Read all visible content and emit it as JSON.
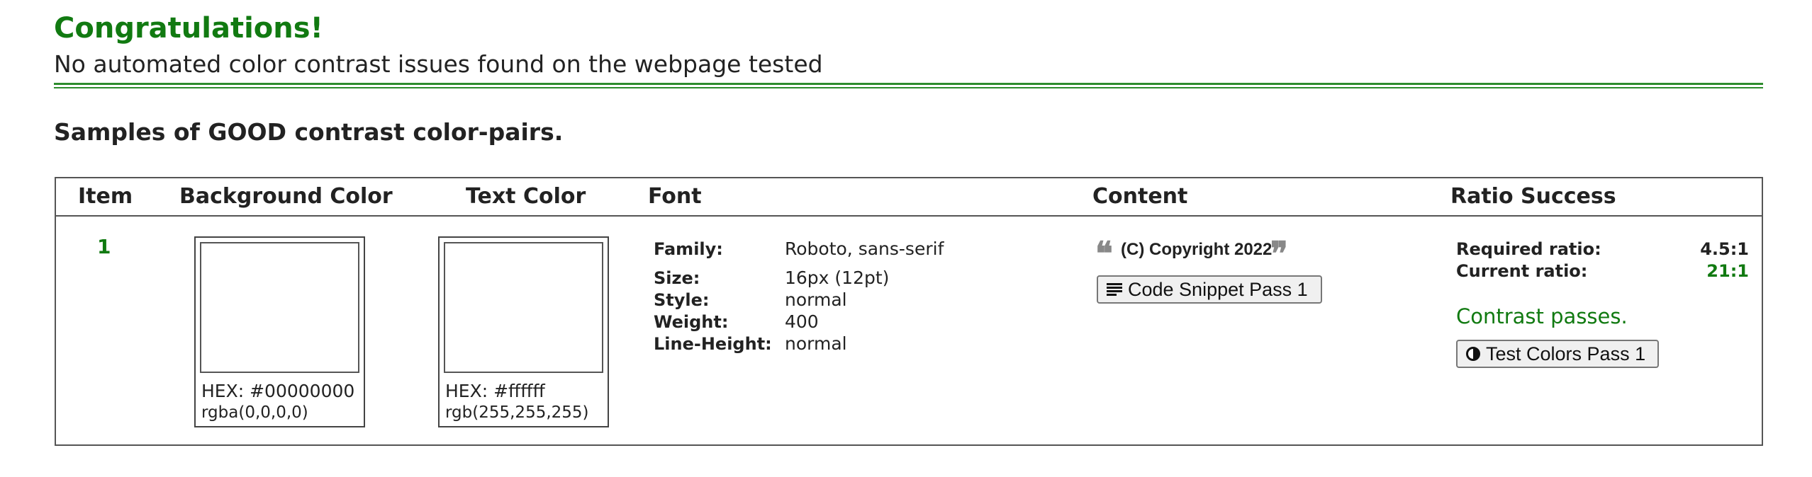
{
  "banner": {
    "title": "Congratulations!",
    "subtitle": "No automated color contrast issues found on the webpage tested"
  },
  "section": {
    "title": "Samples of GOOD contrast color-pairs."
  },
  "table": {
    "headers": {
      "item": "Item",
      "background": "Background Color",
      "text": "Text Color",
      "font": "Font",
      "content": "Content",
      "ratio": "Ratio Success"
    },
    "rows": [
      {
        "item": "1",
        "background": {
          "hex_label": "HEX: #00000000",
          "rgb_label": "rgba(0,0,0,0)",
          "swatch_color": "#ffffff"
        },
        "text": {
          "hex_label": "HEX: #ffffff",
          "rgb_label": "rgb(255,255,255)",
          "swatch_color": "#ffffff"
        },
        "font": {
          "family_label": "Family:",
          "family": "Roboto, sans-serif",
          "size_label": "Size:",
          "size": "16px (12pt)",
          "style_label": "Style:",
          "style": "normal",
          "weight_label": "Weight:",
          "weight": "400",
          "line_height_label": "Line-Height:",
          "line_height": "normal"
        },
        "content": {
          "quote_open": "❝",
          "quote_close": "❞",
          "text": "(C) Copyright 2022",
          "snippet_button": "Code Snippet Pass 1",
          "snippet_icon": "align-justify-icon"
        },
        "ratio": {
          "required_label": "Required ratio:",
          "required_value": "4.5:1",
          "current_label": "Current ratio:",
          "current_value": "21:1",
          "status": "Contrast passes.",
          "test_button": "Test Colors Pass 1",
          "test_icon": "contrast-icon"
        }
      }
    ]
  },
  "colors": {
    "success_green": "#117a11",
    "rule_green": "#2d8c2d",
    "text": "#222222"
  }
}
